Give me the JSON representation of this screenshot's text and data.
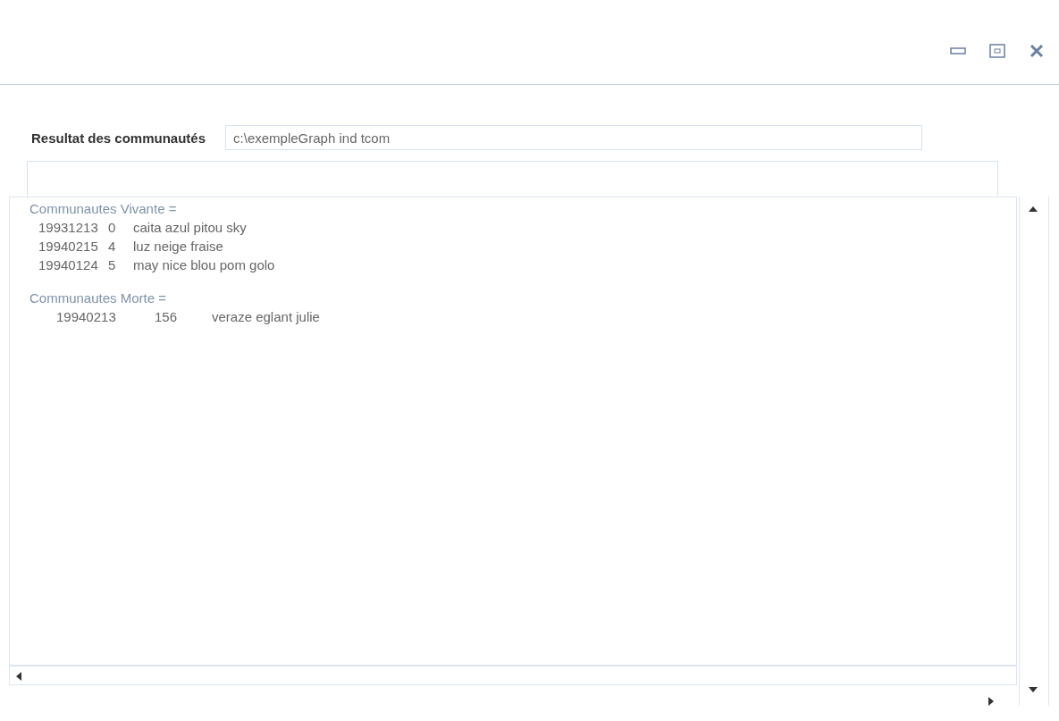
{
  "result_label": "Resultat des communautés",
  "path_field": {
    "value": "c:\\exempleGraph ind tcom"
  },
  "sections": [
    {
      "heading": "Communautes Vivante =",
      "kind": "compact",
      "rows": [
        {
          "date": "19931213",
          "id": "0",
          "names": "caita azul pitou sky"
        },
        {
          "date": "19940215",
          "id": "4",
          "names": "luz neige fraise"
        },
        {
          "date": "19940124",
          "id": "5",
          "names": "may nice blou pom golo"
        }
      ]
    },
    {
      "heading": "Communautes Morte =",
      "kind": "wide",
      "rows": [
        {
          "date": "19940213",
          "id": "156",
          "names": "veraze eglant julie"
        }
      ]
    }
  ]
}
